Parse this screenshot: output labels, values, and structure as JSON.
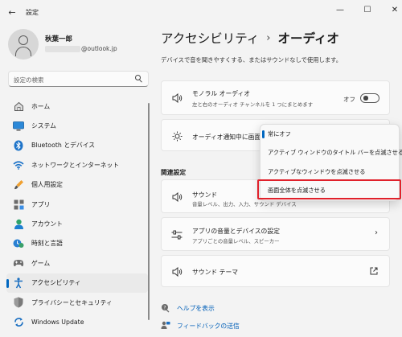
{
  "window": {
    "title": "設定",
    "back_glyph": "←",
    "minimize_glyph": "—",
    "maximize_glyph": "☐",
    "close_glyph": "✕"
  },
  "user": {
    "name": "秋葉一郎",
    "email_suffix": "@outlook.jp"
  },
  "search": {
    "placeholder": "設定の検索"
  },
  "sidebar": {
    "items": [
      {
        "label": "ホーム",
        "icon": "home-icon"
      },
      {
        "label": "システム",
        "icon": "system-icon"
      },
      {
        "label": "Bluetooth とデバイス",
        "icon": "bluetooth-icon"
      },
      {
        "label": "ネットワークとインターネット",
        "icon": "wifi-icon"
      },
      {
        "label": "個人用設定",
        "icon": "brush-icon"
      },
      {
        "label": "アプリ",
        "icon": "apps-icon"
      },
      {
        "label": "アカウント",
        "icon": "account-icon"
      },
      {
        "label": "時刻と言語",
        "icon": "time-language-icon"
      },
      {
        "label": "ゲーム",
        "icon": "gaming-icon"
      },
      {
        "label": "アクセシビリティ",
        "icon": "accessibility-icon",
        "active": true
      },
      {
        "label": "プライバシーとセキュリティ",
        "icon": "shield-icon"
      },
      {
        "label": "Windows Update",
        "icon": "windows-update-icon"
      }
    ]
  },
  "breadcrumb": {
    "parent": "アクセシビリティ",
    "separator": "›",
    "current": "オーディオ"
  },
  "page": {
    "description": "デバイスで音を聞きやすくする、またはサウンドなしで使用します。"
  },
  "cards": {
    "mono_audio": {
      "title": "モノラル オーディオ",
      "subtitle": "左と右のオーディオ チャンネルを 1 つにまとめます",
      "toggle_state": "オフ",
      "toggle_on": false
    },
    "flash": {
      "title": "オーディオ通知中に画面を"
    },
    "sound": {
      "title": "サウンド",
      "subtitle": "音量レベル、出力、入力、サウンド デバイス"
    },
    "app_volume": {
      "title": "アプリの音量とデバイスの設定",
      "subtitle": "アプリごとの音量レベル、スピーカー"
    },
    "sound_theme": {
      "title": "サウンド テーマ"
    }
  },
  "section": {
    "related_settings": "関連設定"
  },
  "dropdown": {
    "options": [
      "常にオフ",
      "アクティブ ウィンドウのタイトル バーを点滅させる",
      "アクティブなウィンドウを点滅させる",
      "画面全体を点滅させる"
    ],
    "selected_index": 0,
    "highlighted_index": 3
  },
  "help": {
    "get_help": "ヘルプを表示",
    "feedback": "フィードバックの送信"
  },
  "colors": {
    "accent": "#0067c0",
    "highlight_border": "#e0212b",
    "link": "#005fb8"
  }
}
